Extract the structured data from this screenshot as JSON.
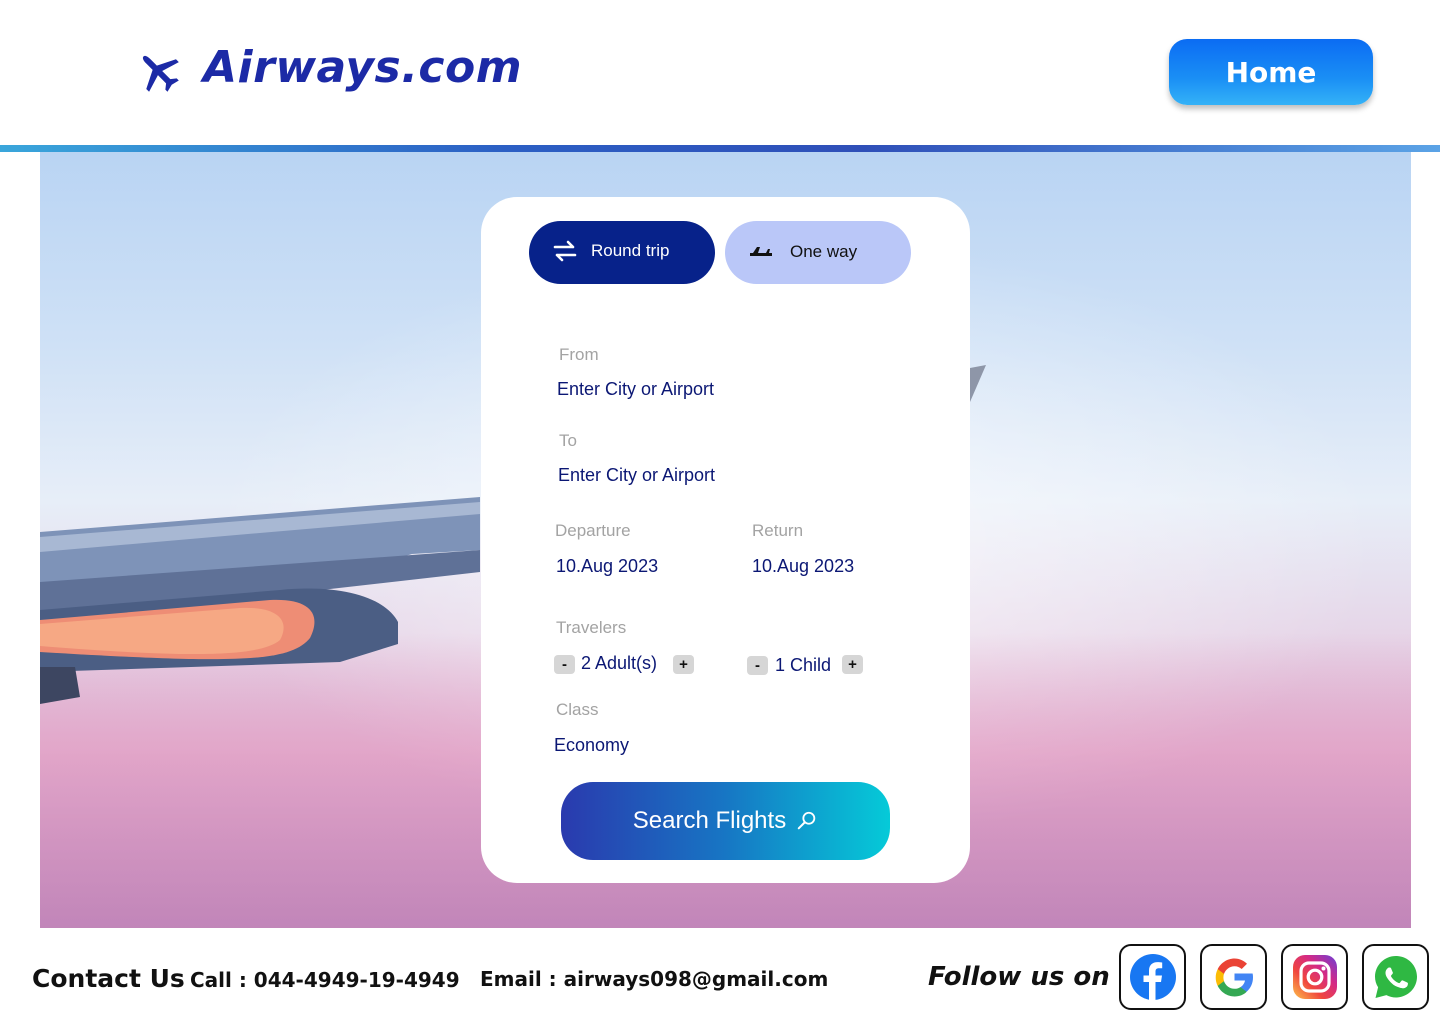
{
  "header": {
    "brand": "Airways.com",
    "logo_icon": "airplane-icon",
    "home_label": "Home"
  },
  "search_card": {
    "trip_types": [
      {
        "label": "Round trip",
        "icon": "swap-arrows-icon",
        "selected": true
      },
      {
        "label": "One way",
        "icon": "plane-takeoff-icon",
        "selected": false
      }
    ],
    "from": {
      "label": "From",
      "value": "Enter City or Airport"
    },
    "to": {
      "label": "To",
      "value": "Enter City or Airport"
    },
    "departure": {
      "label": "Departure",
      "value": "10.Aug 2023"
    },
    "return": {
      "label": "Return",
      "value": "10.Aug 2023"
    },
    "travelers": {
      "label": "Travelers",
      "adults": {
        "value": "2 Adult(s)",
        "minus": "-",
        "plus": "+"
      },
      "children": {
        "value": "1 Child",
        "minus": "-",
        "plus": "+"
      }
    },
    "class": {
      "label": "Class",
      "value": "Economy"
    },
    "search_label": "Search Flights",
    "search_icon": "search-icon"
  },
  "footer": {
    "contact_title": "Contact Us",
    "phone": "Call : 044-4949-19-4949",
    "email": "Email : airways098@gmail.com",
    "follow_title": "Follow us on",
    "socials": [
      "facebook-icon",
      "google-icon",
      "instagram-icon",
      "whatsapp-icon"
    ]
  },
  "colors": {
    "brand_blue": "#1c2aa6",
    "selected_trip": "#07228a",
    "unselected_trip": "#bac7f8",
    "field_value": "#0b1774"
  }
}
